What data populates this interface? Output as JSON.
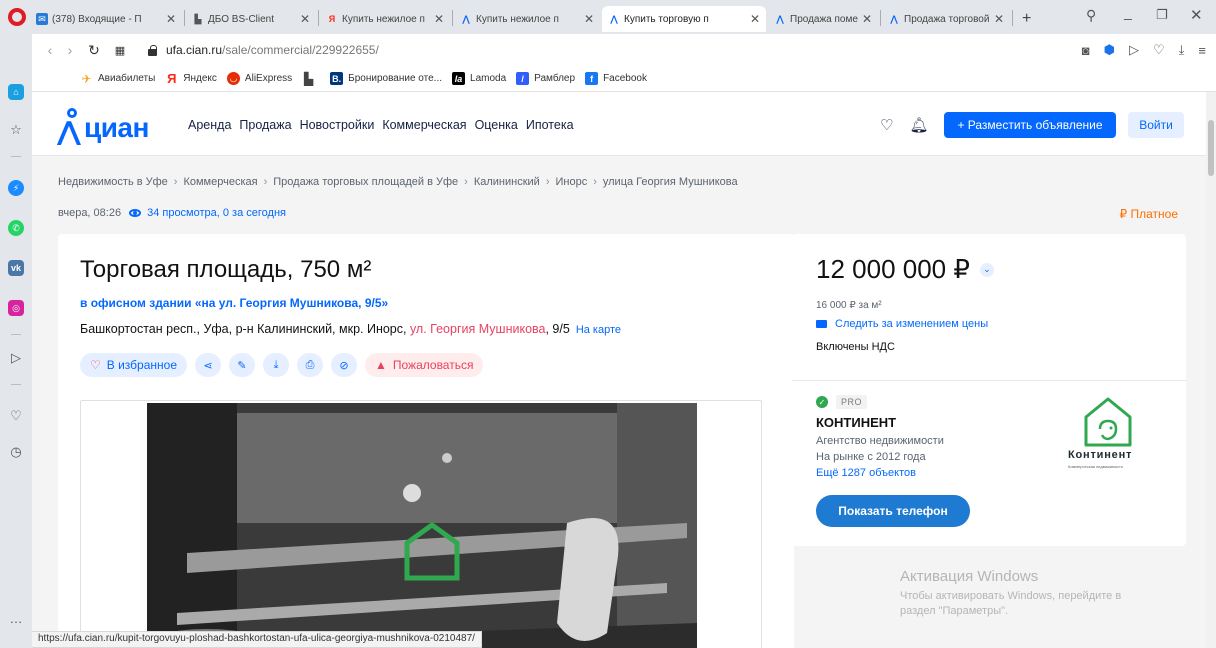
{
  "browser": {
    "tabs": [
      {
        "label": "(378) Входящие - П",
        "favicon": "mail-icon"
      },
      {
        "label": "ДБО BS-Client",
        "favicon": "document-icon"
      },
      {
        "label": "Купить нежилое п",
        "favicon": "yandex-icon"
      },
      {
        "label": "Купить нежилое п",
        "favicon": "cian-icon"
      },
      {
        "label": "Купить торговую п",
        "favicon": "cian-icon",
        "active": true
      },
      {
        "label": "Продажа помещен",
        "favicon": "cian-icon"
      },
      {
        "label": "Продажа торговой",
        "favicon": "cian-icon"
      }
    ],
    "new_tab": "+",
    "url_host": "ufa.cian.ru",
    "url_path": "/sale/commercial/229922655/",
    "bookmarks": [
      {
        "label": "Авиабилеты",
        "icon": "plane-icon",
        "color": "#f5a623"
      },
      {
        "label": "Яндекс",
        "icon": "yandex-icon",
        "color": "#ff2a1a"
      },
      {
        "label": "AliExpress",
        "icon": "aliexpress-icon",
        "color": "#e62e04"
      },
      {
        "label": "",
        "icon": "folder-icon",
        "color": "#444444"
      },
      {
        "label": "Бронирование оте...",
        "icon": "booking-icon",
        "color": "#003580"
      },
      {
        "label": "Lamoda",
        "icon": "lamoda-icon",
        "color": "#000000"
      },
      {
        "label": "Рамблер",
        "icon": "rambler-icon",
        "color": "#315efb"
      },
      {
        "label": "Facebook",
        "icon": "facebook-icon",
        "color": "#1877f2"
      }
    ],
    "status_url": "https://ufa.cian.ru/kupit-torgovuyu-ploshad-bashkortostan-ufa-ulica-georgiya-mushnikova-0210487/"
  },
  "site": {
    "logo": "циан",
    "brand_color": "#0468ff",
    "nav": [
      "Аренда",
      "Продажа",
      "Новостройки",
      "Коммерческая",
      "Оценка",
      "Ипотека"
    ],
    "post_button": "+ Разместить объявление",
    "login_button": "Войти"
  },
  "breadcrumb": [
    "Недвижимость в Уфе",
    "Коммерческая",
    "Продажа торговых площадей в Уфе",
    "Калининский",
    "Инорс",
    "улица Георгия Мушникова"
  ],
  "meta": {
    "date": "вчера, 08:26",
    "views": "34 просмотра, 0 за сегодня",
    "paid": "₽ Платное"
  },
  "listing": {
    "title": "Торговая площадь, 750 м²",
    "building": "в офисном здании «на ул. Георгия Мушникова, 9/5»",
    "address_prefix": "Башкортостан респ., Уфа, р-н Калининский, мкр. Инорс, ",
    "street": "ул. Георгия Мушникова",
    "house": ", 9/5",
    "on_map": "На карте",
    "favorite": "В избранное",
    "report": "Пожаловаться"
  },
  "price": {
    "value": "12 000 000 ₽",
    "per_m2": "16 000 ₽ за м²",
    "follow": "Следить за изменением цены",
    "vat": "Включены НДС"
  },
  "agent": {
    "badge": "PRO",
    "name": "КОНТИНЕНТ",
    "type": "Агентство недвижимости",
    "since": "На рынке с 2012 года",
    "more": "Ещё 1287 объектов",
    "logo_word": "Континент",
    "logo_tagline": "Коммерческая недвижимость",
    "show_phone": "Показать телефон"
  },
  "windows": {
    "heading": "Активация Windows",
    "line1": "Чтобы активировать Windows, перейдите в",
    "line2": "раздел \"Параметры\"."
  }
}
